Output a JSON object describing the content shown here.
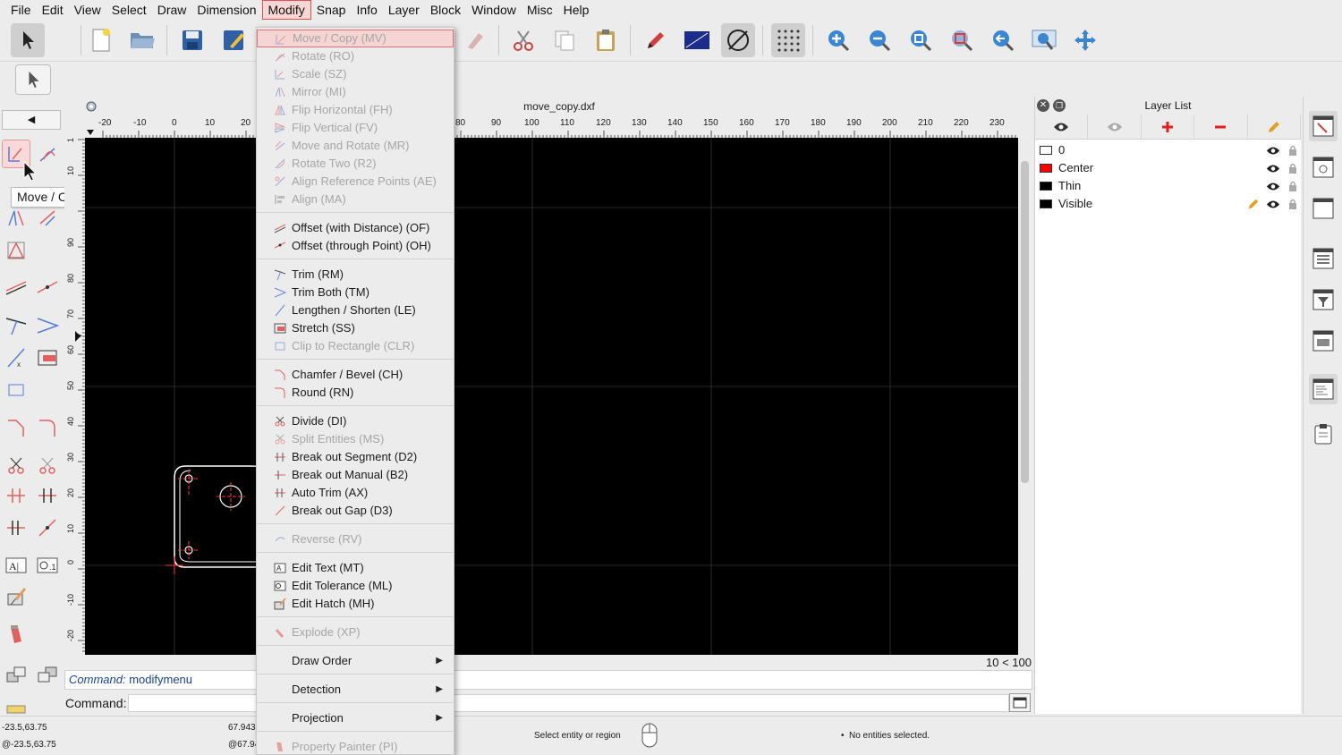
{
  "menubar": {
    "items": [
      "File",
      "Edit",
      "View",
      "Select",
      "Draw",
      "Dimension",
      "Modify",
      "Snap",
      "Info",
      "Layer",
      "Block",
      "Window",
      "Misc",
      "Help"
    ],
    "active": "Modify"
  },
  "tooltip": "Move / Copy",
  "document": {
    "title": "move_copy.dxf"
  },
  "ruler": {
    "top_ticks": [
      "-20",
      "-10",
      "0",
      "10",
      "20",
      "80",
      "90",
      "100",
      "110",
      "120",
      "130",
      "140",
      "150",
      "160",
      "170",
      "180",
      "190",
      "200",
      "210",
      "220",
      "230"
    ],
    "left_ticks": [
      "1",
      "10",
      "90",
      "80",
      "70",
      "60",
      "50",
      "40",
      "30",
      "20",
      "10",
      "0",
      "-10",
      "-20"
    ]
  },
  "zoom_label": "10 < 100",
  "command": {
    "history_prefix": "Command:",
    "history_value": "modifymenu",
    "label": "Command:"
  },
  "status": {
    "coord_abs": "-23.5,63.75",
    "coord_rel": "@-23.5,63.75",
    "coord_polar": "67.943",
    "coord_polar_rel": "@67.94",
    "hint": "Select entity or region",
    "selection": "No entities selected."
  },
  "layers": {
    "title": "Layer List",
    "items": [
      {
        "name": "0",
        "color": "#ffffff"
      },
      {
        "name": "Center",
        "color": "#ff0000"
      },
      {
        "name": "Thin",
        "color": "#000000"
      },
      {
        "name": "Visible",
        "color": "#000000"
      }
    ]
  },
  "menu": {
    "items": [
      {
        "label": "Move / Copy (MV)",
        "disabled": true
      },
      {
        "label": "Rotate (RO)",
        "disabled": true
      },
      {
        "label": "Scale (SZ)",
        "disabled": true
      },
      {
        "label": "Mirror (MI)",
        "disabled": true
      },
      {
        "label": "Flip Horizontal (FH)",
        "disabled": true
      },
      {
        "label": "Flip Vertical (FV)",
        "disabled": true
      },
      {
        "label": "Move and Rotate (MR)",
        "disabled": true
      },
      {
        "label": "Rotate Two (R2)",
        "disabled": true
      },
      {
        "label": "Align Reference Points (AE)",
        "disabled": true
      },
      {
        "label": "Align (MA)",
        "disabled": true
      },
      {
        "label": "Offset (with Distance) (OF)",
        "disabled": false
      },
      {
        "label": "Offset (through Point) (OH)",
        "disabled": false
      },
      {
        "label": "Trim (RM)",
        "disabled": false
      },
      {
        "label": "Trim Both (TM)",
        "disabled": false
      },
      {
        "label": "Lengthen / Shorten (LE)",
        "disabled": false
      },
      {
        "label": "Stretch (SS)",
        "disabled": false
      },
      {
        "label": "Clip to Rectangle (CLR)",
        "disabled": true
      },
      {
        "label": "Chamfer / Bevel (CH)",
        "disabled": false
      },
      {
        "label": "Round (RN)",
        "disabled": false
      },
      {
        "label": "Divide (DI)",
        "disabled": false
      },
      {
        "label": "Split Entities (MS)",
        "disabled": true
      },
      {
        "label": "Break out Segment (D2)",
        "disabled": false
      },
      {
        "label": "Break out Manual (B2)",
        "disabled": false
      },
      {
        "label": "Auto Trim (AX)",
        "disabled": false
      },
      {
        "label": "Break out Gap (D3)",
        "disabled": false
      },
      {
        "label": "Reverse (RV)",
        "disabled": true
      },
      {
        "label": "Edit Text (MT)",
        "disabled": false
      },
      {
        "label": "Edit Tolerance (ML)",
        "disabled": false
      },
      {
        "label": "Edit Hatch (MH)",
        "disabled": false
      },
      {
        "label": "Explode (XP)",
        "disabled": true
      },
      {
        "label": "Draw Order",
        "disabled": false
      },
      {
        "label": "Detection",
        "disabled": false
      },
      {
        "label": "Projection",
        "disabled": false
      },
      {
        "label": "Property Painter (PI)",
        "disabled": true
      }
    ]
  },
  "colors": {
    "accent": "#e25252",
    "canvas": "#000000",
    "drawing_lines": "#ffffff",
    "centerline": "#ff3b3b",
    "disabled_text": "#a6a6a6"
  }
}
